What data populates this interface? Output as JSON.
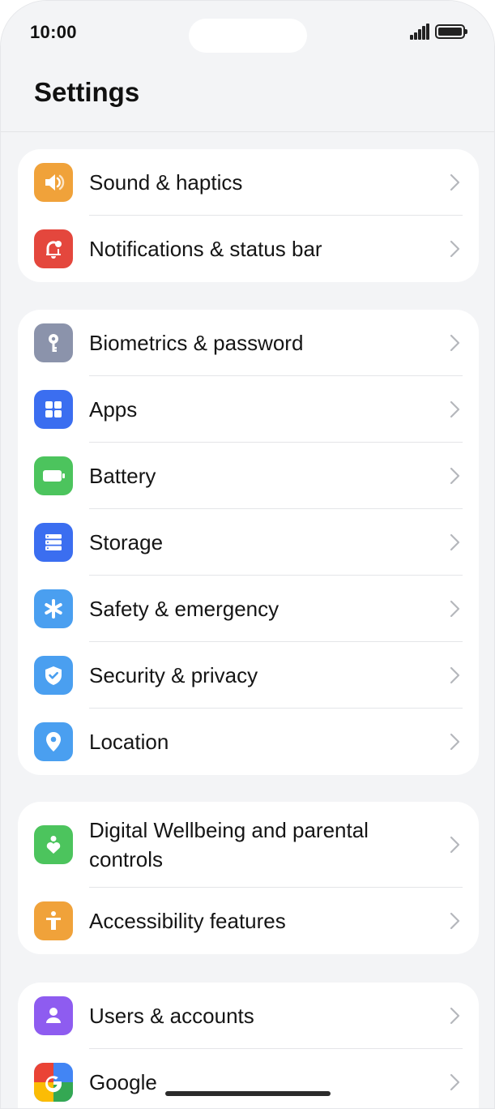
{
  "status_bar": {
    "time": "10:00"
  },
  "header": {
    "title": "Settings"
  },
  "groups": [
    {
      "items": [
        {
          "label": "Sound & haptics",
          "icon": "speaker-icon",
          "color": "#f0a23a"
        },
        {
          "label": "Notifications & status bar",
          "icon": "bell-icon",
          "color": "#e4473d"
        }
      ]
    },
    {
      "items": [
        {
          "label": "Biometrics & password",
          "icon": "key-icon",
          "color": "#8b93ab"
        },
        {
          "label": "Apps",
          "icon": "grid-icon",
          "color": "#3b6ef0"
        },
        {
          "label": "Battery",
          "icon": "battery-icon",
          "color": "#4cc45d"
        },
        {
          "label": "Storage",
          "icon": "storage-icon",
          "color": "#3b6ef0"
        },
        {
          "label": "Safety & emergency",
          "icon": "asterisk-icon",
          "color": "#4a9ff0"
        },
        {
          "label": "Security & privacy",
          "icon": "shield-icon",
          "color": "#4a9ff0"
        },
        {
          "label": "Location",
          "icon": "location-pin-icon",
          "color": "#4a9ff0"
        }
      ]
    },
    {
      "items": [
        {
          "label": "Digital Wellbeing and parental controls",
          "icon": "heart-person-icon",
          "color": "#4cc45d"
        },
        {
          "label": "Accessibility features",
          "icon": "accessibility-icon",
          "color": "#f0a23a"
        }
      ]
    },
    {
      "items": [
        {
          "label": "Users & accounts",
          "icon": "user-icon",
          "color": "#8e5cf0"
        },
        {
          "label": "Google",
          "icon": "google-icon",
          "color": "#4285f4"
        }
      ]
    }
  ]
}
